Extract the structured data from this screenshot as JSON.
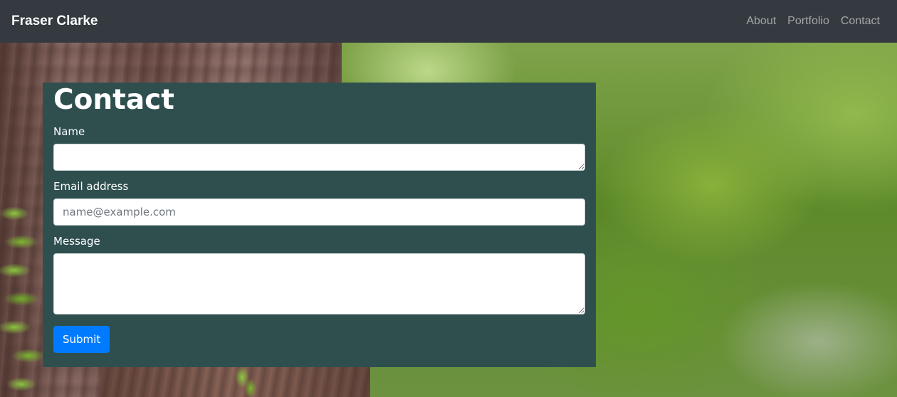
{
  "navbar": {
    "brand": "Fraser Clarke",
    "links": [
      "About",
      "Portfolio",
      "Contact"
    ]
  },
  "contact": {
    "title": "Contact",
    "name_label": "Name",
    "name_value": "",
    "email_label": "Email address",
    "email_value": "",
    "email_placeholder": "name@example.com",
    "message_label": "Message",
    "message_value": "",
    "submit_label": "Submit"
  },
  "colors": {
    "navbar_bg": "#343a40",
    "card_bg": "#2f4f4f",
    "submit_bg": "#007bff"
  },
  "icons": {
    "background": "forest-photo"
  }
}
